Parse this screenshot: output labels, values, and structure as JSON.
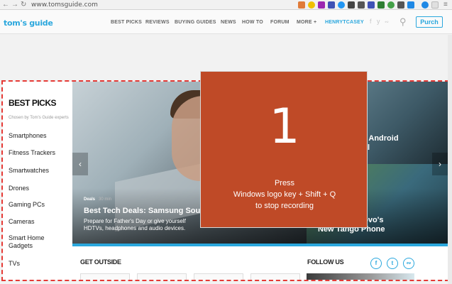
{
  "browser": {
    "url": "www.tomsguide.com",
    "back_icon": "arrow-left-icon",
    "forward_icon": "arrow-right-icon",
    "reload_icon": "reload-icon",
    "extension_colors": [
      "#e07b39",
      "#f0c000",
      "#9c27b0",
      "#3f51b5",
      "#2196f3",
      "#444444",
      "#3f51b5",
      "#2e7d32",
      "#43a047",
      "#555555",
      "#1e88e5",
      "#e0e0e0"
    ]
  },
  "header": {
    "logo": "tom's guide",
    "nav": [
      "BEST PICKS",
      "REVIEWS",
      "BUYING GUIDES",
      "NEWS",
      "HOW TO",
      "FORUM",
      "MORE +",
      "HENRYTCASEY"
    ],
    "social": [
      "f",
      "y",
      "rss"
    ],
    "purch_label": "Purch"
  },
  "best_picks": {
    "title": "BEST PICKS",
    "subtitle": "Chosen by Tom's Guide experts",
    "items": [
      "Smartphones",
      "Fitness Trackers",
      "Smartwatches",
      "Drones",
      "Gaming PCs",
      "Cameras",
      "Smart Home Gadgets",
      "TVs"
    ]
  },
  "hero": {
    "tag": "Deals",
    "time": "30 min",
    "title": "Best Tech Deals: Samsung Sou",
    "desc_line1": "Prepare for Father's Day or give yourself",
    "desc_line2": "HDTVs, headphones and audio devices.",
    "side1_line1": "es on Android",
    "side1_line2": "g Deal",
    "side2_line1": "ent with Lenovo's",
    "side2_line2": "New Tango Phone",
    "prev_arrow": "‹",
    "next_arrow": "›"
  },
  "bottom": {
    "get_outside": "GET OUTSIDE",
    "follow_us": "FOLLOW US",
    "follow_icons": [
      "facebook-icon",
      "twitter-icon",
      "rss-icon"
    ]
  },
  "overlay": {
    "number": "1",
    "line1": "Press",
    "line2": "Windows logo key + Shift + Q",
    "line3": "to stop recording"
  }
}
